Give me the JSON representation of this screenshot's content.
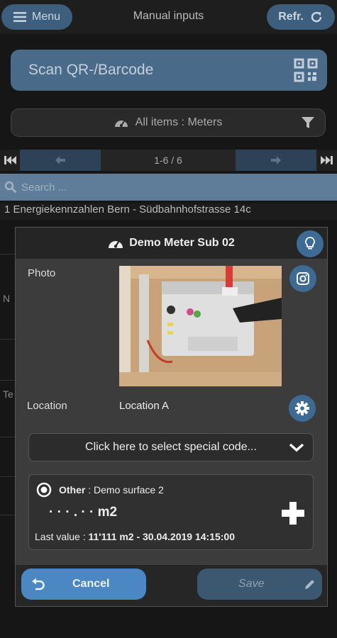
{
  "header": {
    "menu_label": "Menu",
    "title": "Manual inputs",
    "refresh_label": "Refr."
  },
  "scan": {
    "label": "Scan QR-/Barcode"
  },
  "filter": {
    "label": "All items : Meters"
  },
  "pager": {
    "text": "1-6 / 6"
  },
  "search": {
    "placeholder": "Search ..."
  },
  "group": {
    "title": "1 Energiekennzahlen Bern - Südbahnhofstrasse 14c"
  },
  "background": {
    "letter_n": "N",
    "letter_te": "Te"
  },
  "dialog": {
    "title": "Demo Meter Sub 02",
    "photo_label": "Photo",
    "location_label": "Location",
    "location_value": "Location A",
    "special_code": "Click here to select special code...",
    "input": {
      "type_label": "Other",
      "type_value": " : Demo surface 2",
      "value_mask": "· · · . · · m2",
      "last_value_label": "Last value : ",
      "last_value": "11'111 m2 - 30.04.2019 14:15:00"
    },
    "cancel_label": "Cancel",
    "save_label": "Save"
  },
  "colors": {
    "accent": "#4a87c3",
    "header_pill": "#3d5e7d",
    "search_bar": "#5f7d99"
  }
}
